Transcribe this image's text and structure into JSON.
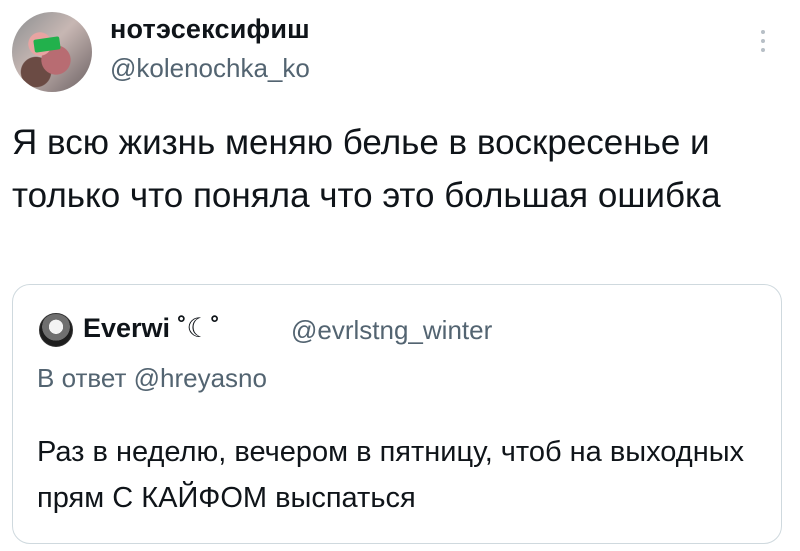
{
  "tweet": {
    "display_name": "нотэсексифиш",
    "handle": "@kolenochka_ko",
    "text": "Я всю жизнь меняю белье в воскресенье и только что поняла что это большая ошибка"
  },
  "quoted_tweet": {
    "display_name": "Everwi ˚☾˚",
    "handle": "@evrlstng_winter",
    "reply_prefix": "В ответ ",
    "reply_to": "@hreyasno",
    "text": "Раз в неделю, вечером в пятницу, чтоб на выходных прям С КАЙФОМ выспаться"
  },
  "icons": {
    "more": "more-vertical-icon"
  },
  "colors": {
    "text": "#0f1419",
    "secondary": "#536471",
    "border": "#cfd9de"
  }
}
